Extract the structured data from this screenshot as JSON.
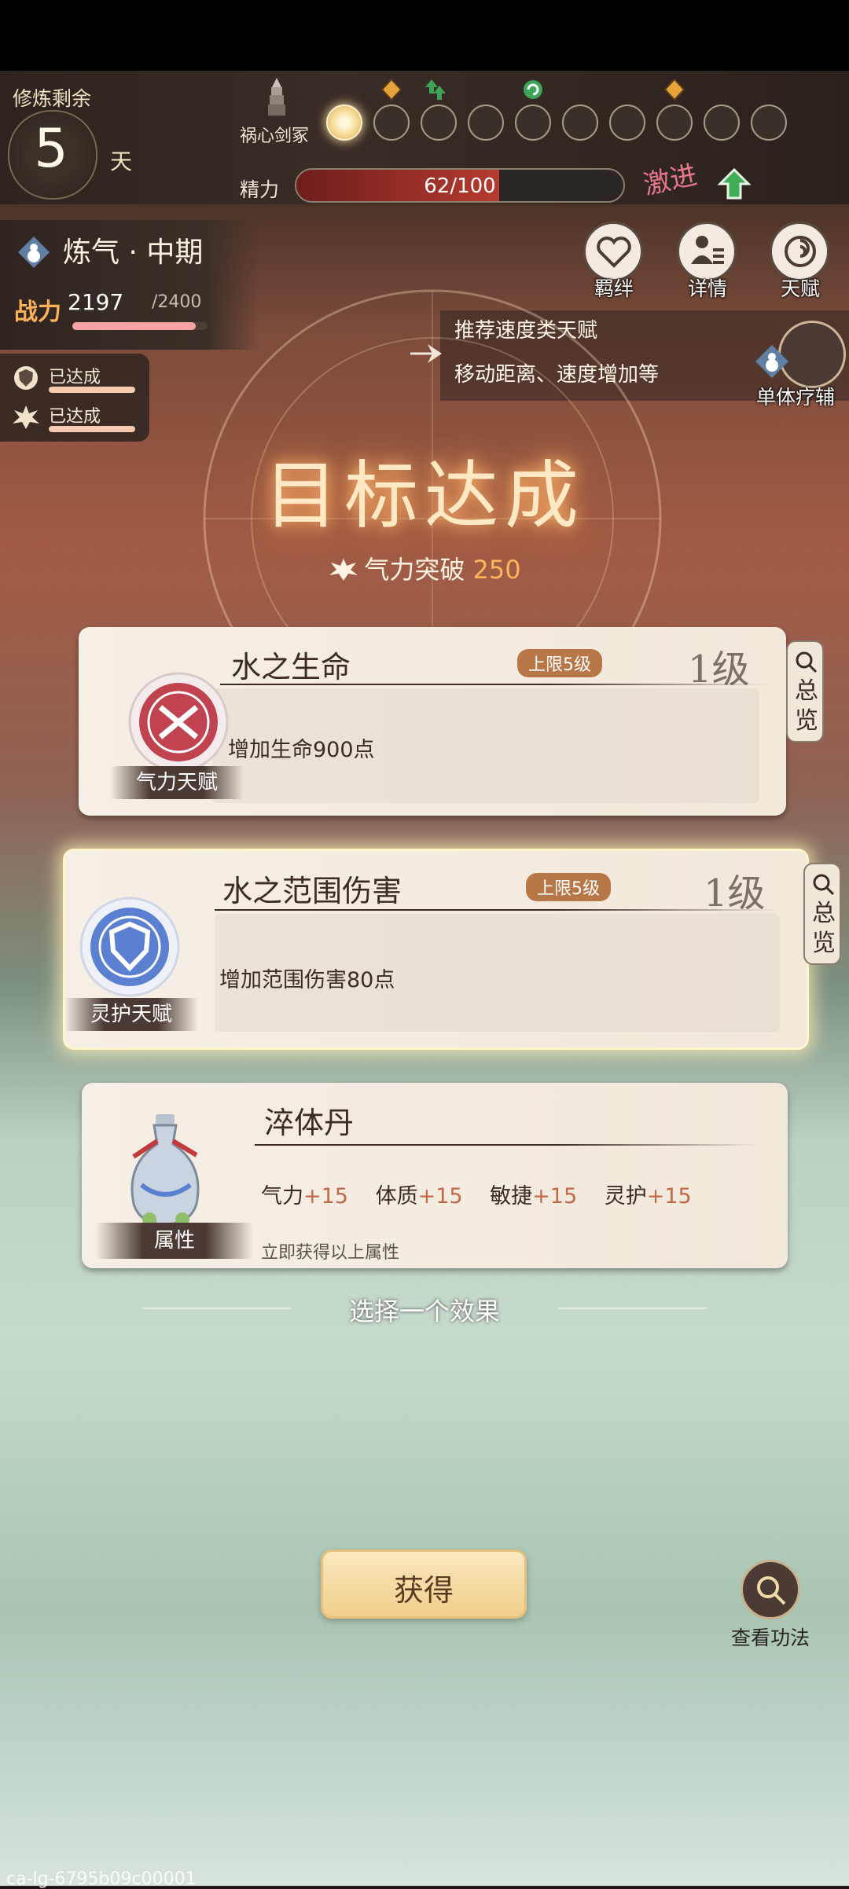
{
  "header": {
    "days_label": "修炼剩余",
    "days_value": "5",
    "days_unit": "天",
    "stage_title": "祸心剑冢",
    "energy_label": "精力",
    "energy_text": "62/100",
    "energy_fraction": 0.62,
    "ji_label": "激进"
  },
  "realm": {
    "name": "炼气 · 中期",
    "power_label": "战力",
    "power_value": "2197",
    "power_max": "/2400",
    "power_fraction": 0.9154
  },
  "achievements": [
    {
      "label": "已达成"
    },
    {
      "label": "已达成"
    }
  ],
  "actions": [
    {
      "label": "羁绊",
      "icon": "heart-icon"
    },
    {
      "label": "详情",
      "icon": "person-list-icon"
    },
    {
      "label": "天赋",
      "icon": "swirl-icon"
    }
  ],
  "recommend": {
    "line1": "推荐速度类天赋",
    "line2": "移动距离、速度增加等",
    "heal_label": "单体疗辅"
  },
  "goal": {
    "title": "目标达成",
    "breakthrough_label": "气力突破",
    "breakthrough_value": "250"
  },
  "cards": [
    {
      "title": "水之生命",
      "cap": "上限5级",
      "level": "1级",
      "desc": "增加生命900点",
      "category": "气力天赋",
      "overview": "总览",
      "color": "#c0434f"
    },
    {
      "title": "水之范围伤害",
      "cap": "上限5级",
      "level": "1级",
      "desc": "增加范围伤害80点",
      "category": "灵护天赋",
      "overview": "总览",
      "color": "#5b7fd1"
    }
  ],
  "pill": {
    "title": "淬体丹",
    "category": "属性",
    "note": "立即获得以上属性",
    "stats": [
      {
        "name": "气力",
        "plus": "+15"
      },
      {
        "name": "体质",
        "plus": "+15"
      },
      {
        "name": "敏捷",
        "plus": "+15"
      },
      {
        "name": "灵护",
        "plus": "+15"
      }
    ]
  },
  "choose_label": "选择一个效果",
  "obtain_label": "获得",
  "skill_label": "查看功法",
  "watermark": "ca-lg-6795b09c00001"
}
